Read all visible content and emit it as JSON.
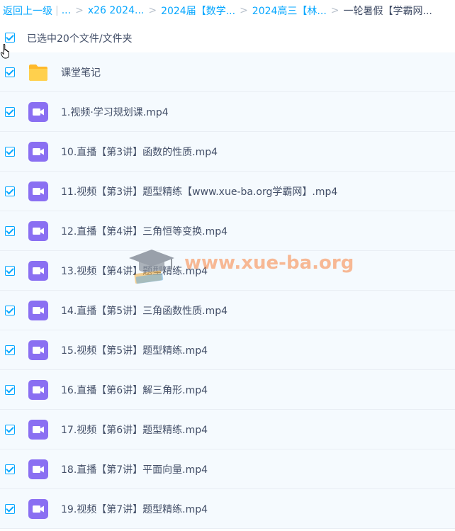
{
  "breadcrumb": {
    "back_label": "返回上一级",
    "pipe": "|",
    "ellipsis": "...",
    "separator": ">",
    "items": [
      "x26 2024...",
      "2024届【数学...",
      "2024高三【林..."
    ],
    "current": "一轮暑假【学霸网..."
  },
  "selection": {
    "label": "已选中20个文件/文件夹",
    "checked": true
  },
  "files": [
    {
      "name": "课堂笔记",
      "type": "folder",
      "checked": true
    },
    {
      "name": "1.视频·学习规划课.mp4",
      "type": "video",
      "checked": true
    },
    {
      "name": "10.直播【第3讲】函数的性质.mp4",
      "type": "video",
      "checked": true
    },
    {
      "name": "11.视频【第3讲】题型精练【www.xue-ba.org学霸网】.mp4",
      "type": "video",
      "checked": true
    },
    {
      "name": "12.直播【第4讲】三角恒等变换.mp4",
      "type": "video",
      "checked": true
    },
    {
      "name": "13.视频【第4讲】题型精练.mp4",
      "type": "video",
      "checked": true
    },
    {
      "name": "14.直播【第5讲】三角函数性质.mp4",
      "type": "video",
      "checked": true
    },
    {
      "name": "15.视频【第5讲】题型精练.mp4",
      "type": "video",
      "checked": true
    },
    {
      "name": "16.直播【第6讲】解三角形.mp4",
      "type": "video",
      "checked": true
    },
    {
      "name": "17.视频【第6讲】题型精练.mp4",
      "type": "video",
      "checked": true
    },
    {
      "name": "18.直播【第7讲】平面向量.mp4",
      "type": "video",
      "checked": true
    },
    {
      "name": "19.视频【第7讲】题型精练.mp4",
      "type": "video",
      "checked": true
    }
  ],
  "watermark": {
    "text": "www.xue-ba.org"
  },
  "colors": {
    "accent": "#06a7ff",
    "folder": "#ffc83d",
    "video": "#8a6ff2",
    "row_bg": "#f5fafe",
    "text": "#424e67"
  }
}
